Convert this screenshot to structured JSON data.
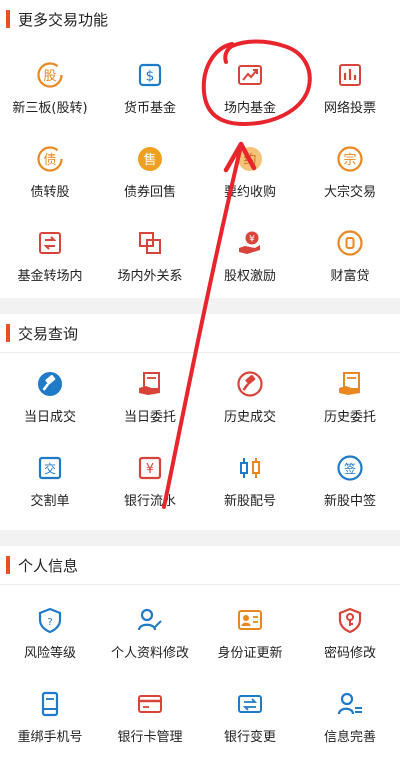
{
  "colors": {
    "accent": "#e8501f",
    "icon_blue": "#1f7ac7",
    "icon_orange": "#e8881f",
    "icon_red": "#d9443a",
    "annotation_red": "#e8242c"
  },
  "sections": [
    {
      "title": "更多交易功能",
      "items": [
        {
          "label": "新三板(股转)",
          "icon": "gu-circle-icon"
        },
        {
          "label": "货币基金",
          "icon": "dollar-square-icon"
        },
        {
          "label": "场内基金",
          "icon": "trend-chart-icon"
        },
        {
          "label": "网络投票",
          "icon": "bar-chart-icon"
        },
        {
          "label": "债转股",
          "icon": "zhai-circle-icon"
        },
        {
          "label": "债券回售",
          "icon": "shou-circle-icon"
        },
        {
          "label": "要约收购",
          "icon": "yue-circle-icon"
        },
        {
          "label": "大宗交易",
          "icon": "zong-circle-icon"
        },
        {
          "label": "基金转场内",
          "icon": "transfer-arrows-icon"
        },
        {
          "label": "场内外关系",
          "icon": "overlap-squares-icon"
        },
        {
          "label": "股权激励",
          "icon": "yen-hand-icon"
        },
        {
          "label": "财富贷",
          "icon": "coin-circle-icon"
        }
      ]
    },
    {
      "title": "交易查询",
      "items": [
        {
          "label": "当日成交",
          "icon": "hammer-circle-icon"
        },
        {
          "label": "当日委托",
          "icon": "hand-document-icon"
        },
        {
          "label": "历史成交",
          "icon": "hammer-circle-icon"
        },
        {
          "label": "历史委托",
          "icon": "hand-document-icon"
        },
        {
          "label": "交割单",
          "icon": "jiao-square-icon"
        },
        {
          "label": "银行流水",
          "icon": "yen-square-icon"
        },
        {
          "label": "新股配号",
          "icon": "candlestick-icon"
        },
        {
          "label": "新股中签",
          "icon": "qian-circle-icon"
        }
      ]
    },
    {
      "title": "个人信息",
      "items": [
        {
          "label": "风险等级",
          "icon": "shield-icon"
        },
        {
          "label": "个人资料修改",
          "icon": "user-edit-icon"
        },
        {
          "label": "身份证更新",
          "icon": "id-card-icon"
        },
        {
          "label": "密码修改",
          "icon": "key-shield-icon"
        },
        {
          "label": "重绑手机号",
          "icon": "phone-icon"
        },
        {
          "label": "银行卡管理",
          "icon": "bank-card-icon"
        },
        {
          "label": "银行变更",
          "icon": "card-switch-icon"
        },
        {
          "label": "信息完善",
          "icon": "user-list-icon"
        }
      ]
    }
  ]
}
